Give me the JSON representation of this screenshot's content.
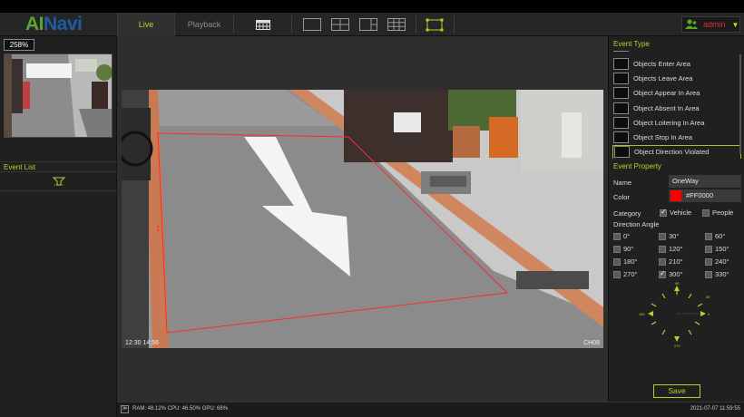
{
  "app": {
    "logo_ai": "AI",
    "logo_navi": "Navi"
  },
  "header": {
    "tabs": [
      {
        "label": "Live",
        "active": true
      },
      {
        "label": "Playback",
        "active": false
      }
    ],
    "toolbar_icons": [
      "calendar-grid-icon",
      "layout-1-icon",
      "layout-4-icon",
      "layout-6-icon",
      "layout-9-icon",
      "fullscreen-icon"
    ],
    "user": {
      "name": "admin"
    }
  },
  "left": {
    "zoom": "258%",
    "event_list_title": "Event List"
  },
  "video": {
    "timestamp": "12:30 14:56",
    "channel": "CH08",
    "roi_label": "1",
    "roi_color": "#FF0000"
  },
  "right": {
    "event_type_title": "Event Type",
    "event_types": [
      {
        "label": "Objects Enter Area",
        "selected": false
      },
      {
        "label": "Objects Leave Area",
        "selected": false
      },
      {
        "label": "Object Appear In Area",
        "selected": false
      },
      {
        "label": "Object Absent In Area",
        "selected": false
      },
      {
        "label": "Object Loitering In Area",
        "selected": false
      },
      {
        "label": "Object Stop In Area",
        "selected": false
      },
      {
        "label": "Object Direction Violated",
        "selected": true
      }
    ],
    "event_property_title": "Event Property",
    "name_label": "Name",
    "name_value": "OneWay",
    "color_label": "Color",
    "color_value": "#FF0000",
    "category_label": "Category",
    "categories": [
      {
        "label": "Vehicle",
        "checked": true
      },
      {
        "label": "People",
        "checked": false
      }
    ],
    "direction_label": "Direction Angle",
    "angles": [
      {
        "label": "0°",
        "checked": false
      },
      {
        "label": "30°",
        "checked": false
      },
      {
        "label": "60°",
        "checked": false
      },
      {
        "label": "90°",
        "checked": false
      },
      {
        "label": "120°",
        "checked": false
      },
      {
        "label": "150°",
        "checked": false
      },
      {
        "label": "180°",
        "checked": false
      },
      {
        "label": "210°",
        "checked": false
      },
      {
        "label": "240°",
        "checked": false
      },
      {
        "label": "270°",
        "checked": false
      },
      {
        "label": "300°",
        "checked": true
      },
      {
        "label": "330°",
        "checked": false
      }
    ],
    "dial": {
      "n": "90",
      "e": "0",
      "s": "270",
      "w": "180",
      "ne": "30"
    },
    "save_label": "Save"
  },
  "status": {
    "metrics": "RAM: 48.12% CPU: 46.50% GPU: 68%",
    "datetime": "2021-07-07 11:59:55"
  },
  "colors": {
    "accent": "#b6d32b",
    "alert": "#e03030"
  }
}
